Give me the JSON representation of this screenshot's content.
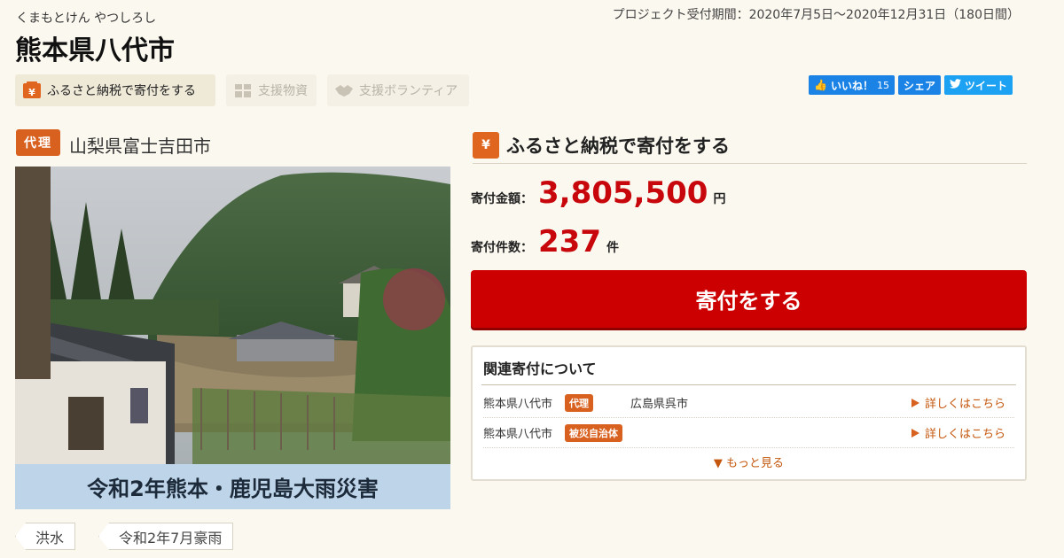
{
  "header": {
    "furigana": "くまもとけん やつしろし",
    "title": "熊本県八代市",
    "period": "プロジェクト受付期間：2020年7月5日〜2020年12月31日（180日間）"
  },
  "tabs": [
    {
      "label": "ふるさと納税で寄付をする",
      "icon": "yen-box-icon",
      "active": true
    },
    {
      "label": "支援物資",
      "icon": "package-icon",
      "active": false
    },
    {
      "label": "支援ボランティア",
      "icon": "handshake-icon",
      "active": false
    }
  ],
  "social": {
    "like_label": "いいね！",
    "like_count": "15",
    "share_label": "シェア",
    "tweet_label": "ツイート"
  },
  "proxy": {
    "badge": "代理",
    "city": "山梨県富士吉田市"
  },
  "photo": {
    "caption": "令和2年熊本・鹿児島大雨災害"
  },
  "tags": [
    "洪水",
    "令和2年7月豪雨"
  ],
  "donation": {
    "heading": "ふるさと納税で寄付をする",
    "amount_label": "寄付金額：",
    "amount_value": "3,805,500",
    "amount_unit": "円",
    "count_label": "寄付件数：",
    "count_value": "237",
    "count_unit": "件",
    "button_label": "寄付をする"
  },
  "related": {
    "title": "関連寄付について",
    "rows": [
      {
        "city": "熊本県八代市",
        "badge": "代理",
        "other": "広島県呉市",
        "link": "詳しくはこちら"
      },
      {
        "city": "熊本県八代市",
        "badge": "被災自治体",
        "other": "",
        "link": "詳しくはこちら"
      }
    ],
    "more_label": "▼ もっと見る"
  },
  "colors": {
    "accent_orange": "#d9611f",
    "donate_red": "#cc0000",
    "value_red": "#c8070c",
    "social_blue": "#1b83e6",
    "caption_blue": "#bdd4e9"
  }
}
